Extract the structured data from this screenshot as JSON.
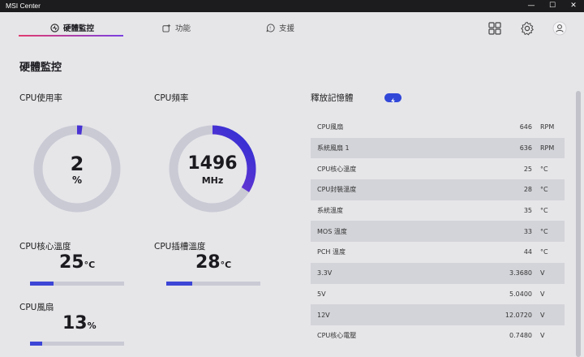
{
  "window": {
    "title": "MSI Center",
    "minimize": "—",
    "maximize": "☐",
    "close": "✕"
  },
  "nav": {
    "tabs": [
      {
        "label": "硬體監控",
        "icon": "monitor-icon"
      },
      {
        "label": "功能",
        "icon": "feature-icon"
      },
      {
        "label": "支援",
        "icon": "support-icon"
      }
    ],
    "accent_gradient": [
      "#e23c6f",
      "#7b3fe0"
    ]
  },
  "page": {
    "title": "硬體監控"
  },
  "cpu_usage": {
    "label": "CPU使用率",
    "value": "2",
    "unit": "%",
    "fraction": 0.02
  },
  "cpu_freq": {
    "label": "CPU頻率",
    "value": "1496",
    "unit": "MHz",
    "fraction": 0.34
  },
  "cpu_temp": {
    "label": "CPU核心溫度",
    "value": "25",
    "unit": "°C",
    "fraction": 0.25
  },
  "cpu_socket_temp": {
    "label": "CPU插槽溫度",
    "value": "28",
    "unit": "°C",
    "fraction": 0.28
  },
  "cpu_fan": {
    "label": "CPU風扇",
    "value": "13",
    "unit": "%",
    "fraction": 0.13
  },
  "free_memory": {
    "label": "釋放記憶體"
  },
  "sensors": [
    {
      "name": "CPU風扇",
      "value": "646",
      "unit": "RPM"
    },
    {
      "name": "系統風扇 1",
      "value": "636",
      "unit": "RPM"
    },
    {
      "name": "CPU核心溫度",
      "value": "25",
      "unit": "°C"
    },
    {
      "name": "CPU封裝溫度",
      "value": "28",
      "unit": "°C"
    },
    {
      "name": "系統溫度",
      "value": "35",
      "unit": "°C"
    },
    {
      "name": "MOS 溫度",
      "value": "33",
      "unit": "°C"
    },
    {
      "name": "PCH 溫度",
      "value": "44",
      "unit": "°C"
    },
    {
      "name": "3.3V",
      "value": "3.3680",
      "unit": "V"
    },
    {
      "name": "5V",
      "value": "5.0400",
      "unit": "V"
    },
    {
      "name": "12V",
      "value": "12.0720",
      "unit": "V"
    },
    {
      "name": "CPU核心電壓",
      "value": "0.7480",
      "unit": "V"
    }
  ],
  "colors": {
    "ring_track": "#c9cad4",
    "ring_start": "#a63ad0",
    "ring_end": "#2b2fd4",
    "bar_fill": "#3d46d6"
  }
}
